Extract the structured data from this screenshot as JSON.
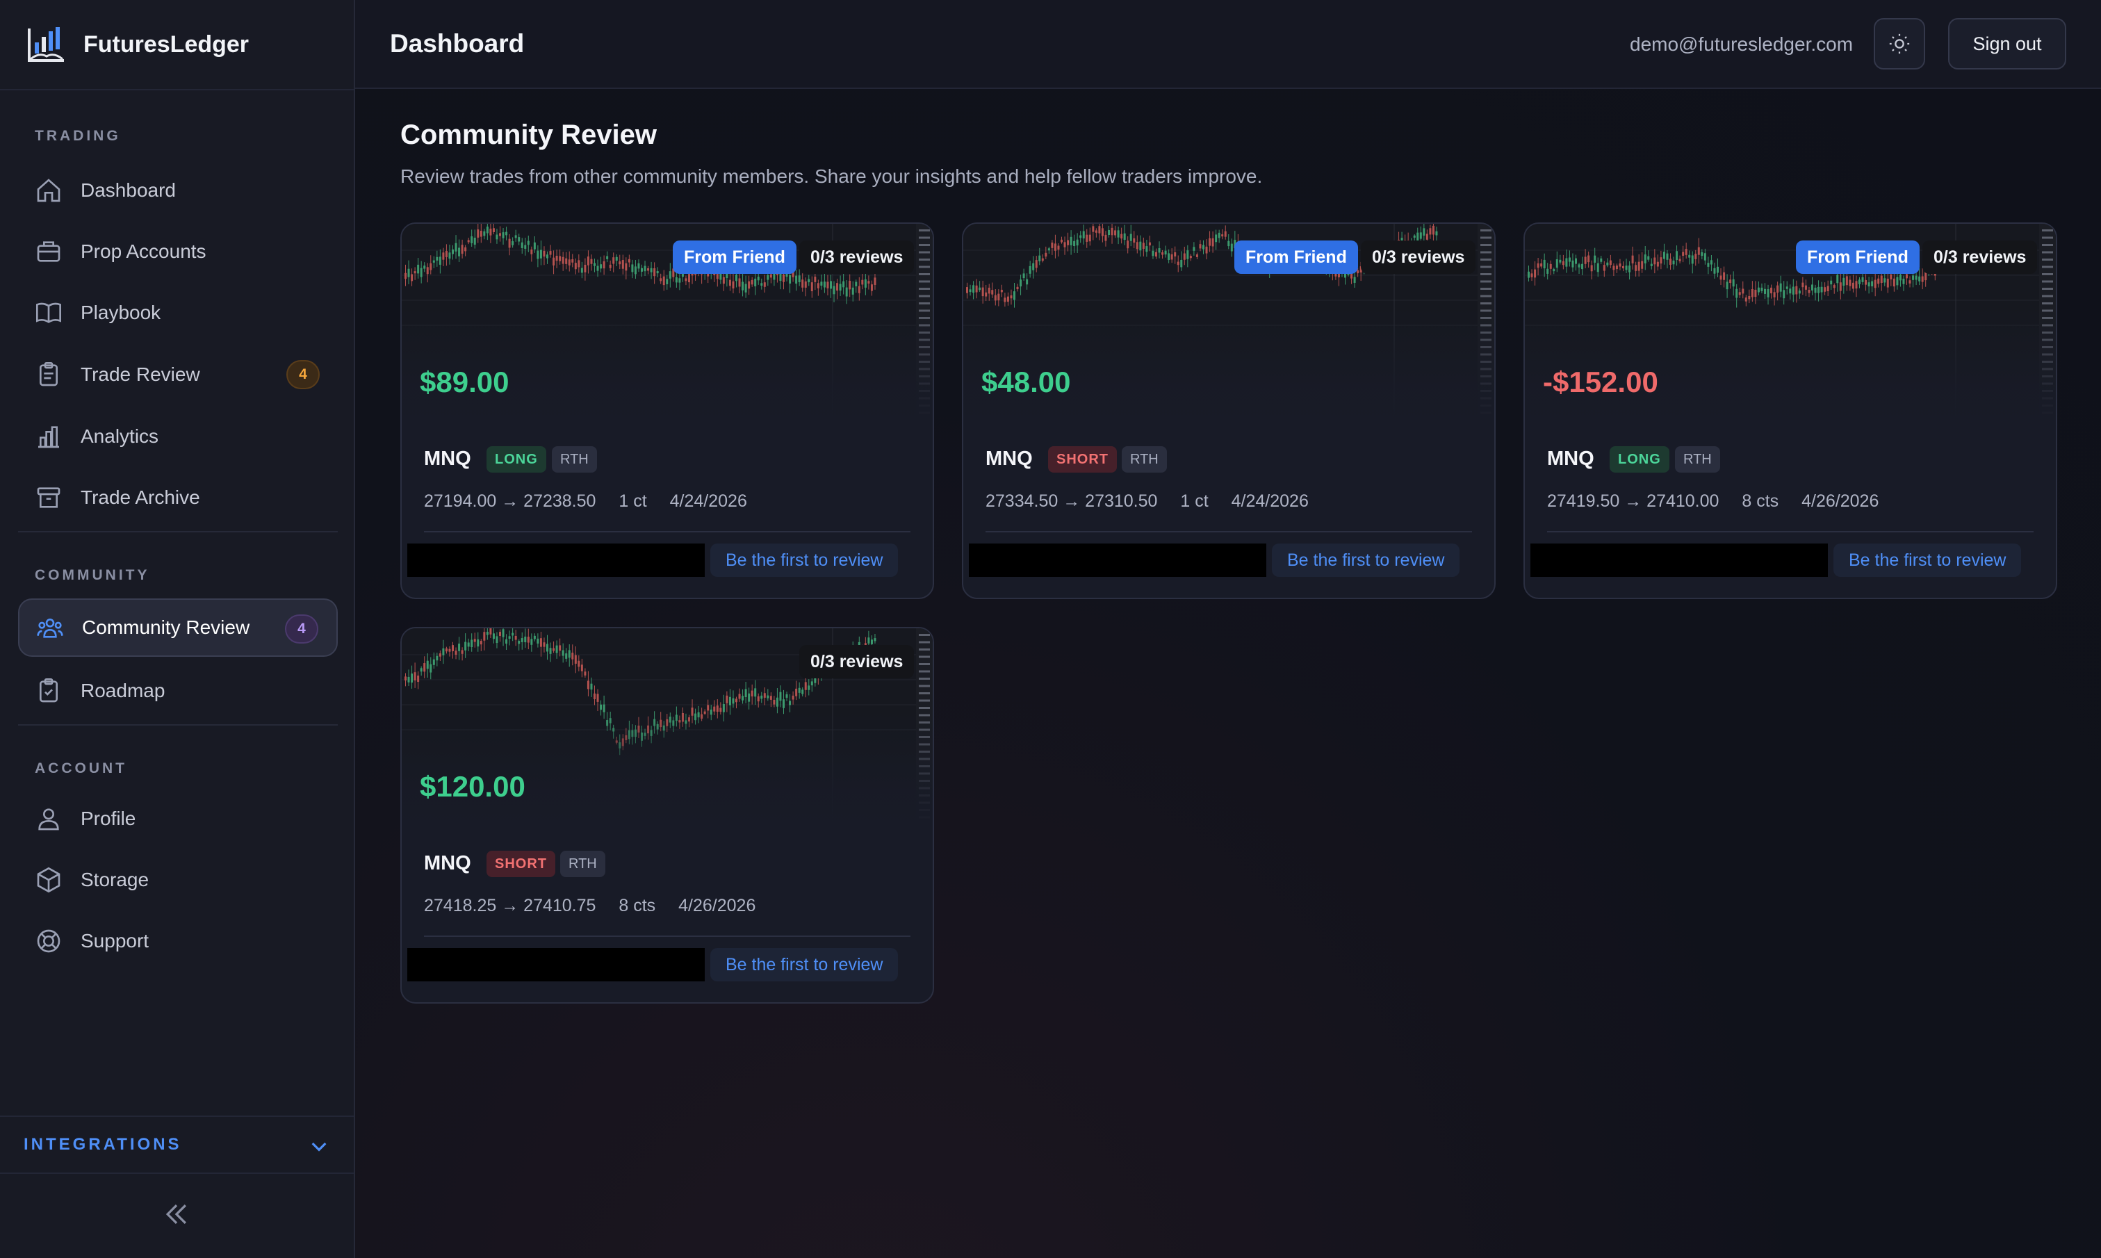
{
  "app": {
    "name": "FuturesLedger"
  },
  "header": {
    "title": "Dashboard",
    "email": "demo@futuresledger.com",
    "sign_out": "Sign out"
  },
  "sidebar": {
    "sections": [
      {
        "title": "TRADING"
      },
      {
        "title": "COMMUNITY"
      },
      {
        "title": "ACCOUNT"
      }
    ],
    "items": [
      {
        "label": "Dashboard",
        "icon": "home-icon"
      },
      {
        "label": "Prop Accounts",
        "icon": "briefcase-icon"
      },
      {
        "label": "Playbook",
        "icon": "book-icon"
      },
      {
        "label": "Trade Review",
        "icon": "clipboard-icon",
        "badge": "4"
      },
      {
        "label": "Analytics",
        "icon": "bar-chart-icon"
      },
      {
        "label": "Trade Archive",
        "icon": "archive-icon"
      },
      {
        "label": "Community Review",
        "icon": "users-icon",
        "badge": "4",
        "active": true
      },
      {
        "label": "Roadmap",
        "icon": "clipboard-check-icon"
      },
      {
        "label": "Profile",
        "icon": "user-icon"
      },
      {
        "label": "Storage",
        "icon": "box-icon"
      },
      {
        "label": "Support",
        "icon": "lifebuoy-icon"
      }
    ],
    "integrations": "INTEGRATIONS"
  },
  "page": {
    "title": "Community Review",
    "subtitle": "Review trades from other community members. Share your insights and help fellow traders improve."
  },
  "cards": [
    {
      "pnl": "$89.00",
      "pnl_sign": "pos",
      "from_friend": "From Friend",
      "reviews": "0/3 reviews",
      "symbol": "MNQ",
      "side": "LONG",
      "session": "RTH",
      "prices": "27194.00 → 27238.50",
      "size": "1 ct",
      "date": "4/24/2026",
      "cta": "Be the first to review"
    },
    {
      "pnl": "$48.00",
      "pnl_sign": "pos",
      "from_friend": "From Friend",
      "reviews": "0/3 reviews",
      "symbol": "MNQ",
      "side": "SHORT",
      "session": "RTH",
      "prices": "27334.50 → 27310.50",
      "size": "1 ct",
      "date": "4/24/2026",
      "cta": "Be the first to review"
    },
    {
      "pnl": "-$152.00",
      "pnl_sign": "neg",
      "from_friend": "From Friend",
      "reviews": "0/3 reviews",
      "symbol": "MNQ",
      "side": "LONG",
      "session": "RTH",
      "prices": "27419.50 → 27410.00",
      "size": "8 cts",
      "date": "4/26/2026",
      "cta": "Be the first to review"
    },
    {
      "pnl": "$120.00",
      "pnl_sign": "pos",
      "reviews": "0/3 reviews",
      "symbol": "MNQ",
      "side": "SHORT",
      "session": "RTH",
      "prices": "27418.25 → 27410.75",
      "size": "8 cts",
      "date": "4/26/2026",
      "cta": "Be the first to review"
    }
  ],
  "colors": {
    "accent": "#4f8ff7",
    "profit": "#3ecf8e",
    "loss": "#f06a6a",
    "friend_badge": "#2f6fe4"
  }
}
